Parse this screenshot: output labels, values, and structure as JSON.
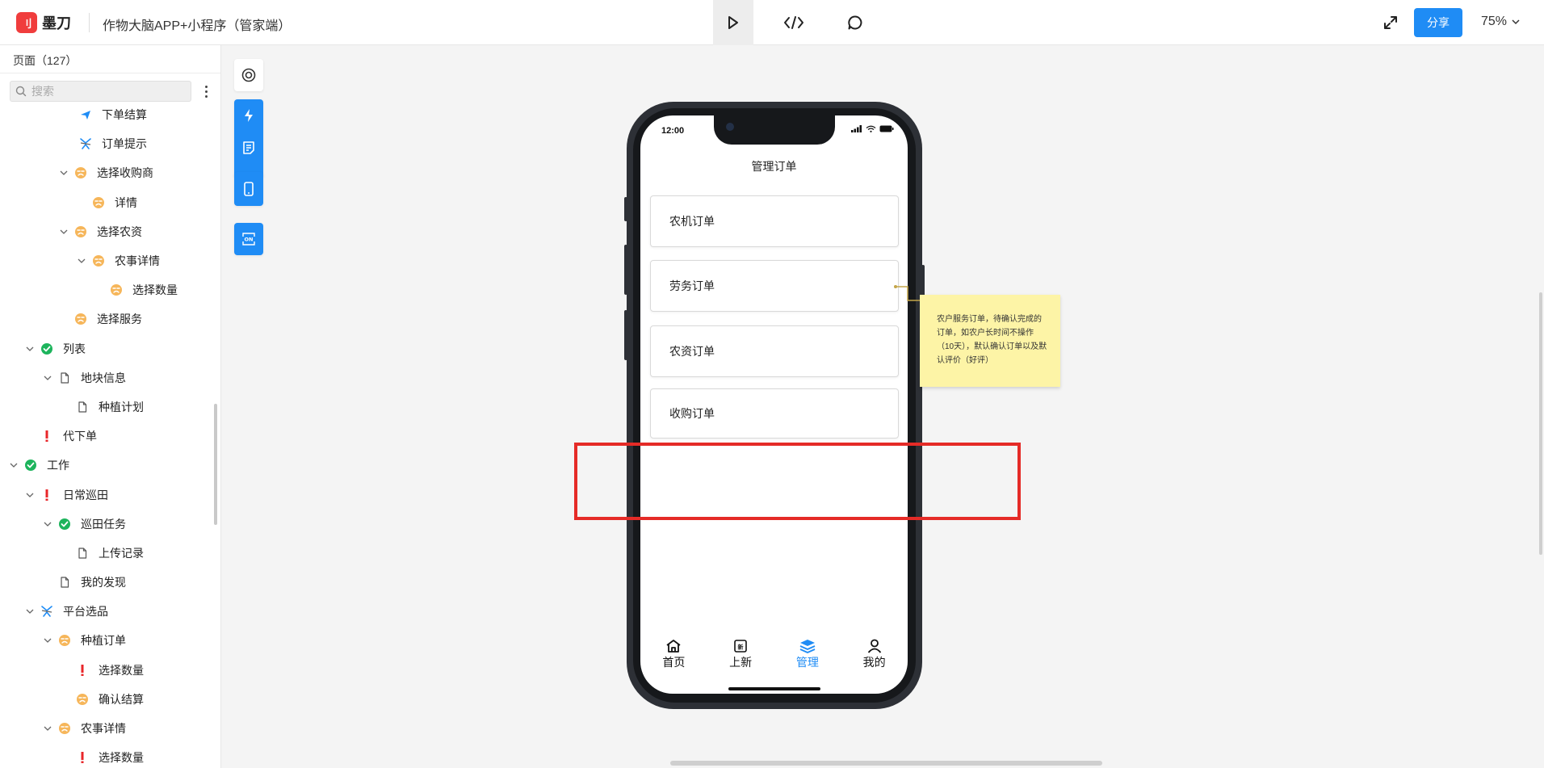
{
  "topbar": {
    "logo_mark": "刂",
    "logo_text": "墨刀",
    "project_title": "作物大脑APP+小程序（管家端）",
    "share_label": "分享",
    "zoom_label": "75%"
  },
  "sidebar": {
    "header": "页面（127）",
    "search_placeholder": "搜索",
    "items": [
      {
        "label": "下单结算",
        "icon": "plane-icon"
      },
      {
        "label": "订单提示",
        "icon": "plane-icon"
      },
      {
        "label": "选择收购商",
        "icon": "pending-icon"
      },
      {
        "label": "详情",
        "icon": "pending-icon"
      },
      {
        "label": "选择农资",
        "icon": "pending-icon"
      },
      {
        "label": "农事详情",
        "icon": "pending-icon"
      },
      {
        "label": "选择数量",
        "icon": "pending-icon"
      },
      {
        "label": "选择服务",
        "icon": "pending-icon"
      },
      {
        "label": "列表",
        "icon": "done-icon"
      },
      {
        "label": "地块信息",
        "icon": "page-icon"
      },
      {
        "label": "种植计划",
        "icon": "page-icon"
      },
      {
        "label": "代下单",
        "icon": "alert-icon"
      },
      {
        "label": "工作",
        "icon": "done-icon"
      },
      {
        "label": "日常巡田",
        "icon": "alert-icon"
      },
      {
        "label": "巡田任务",
        "icon": "done-icon"
      },
      {
        "label": "上传记录",
        "icon": "page-icon"
      },
      {
        "label": "我的发现",
        "icon": "page-icon"
      },
      {
        "label": "平台选品",
        "icon": "plane-icon"
      },
      {
        "label": "种植订单",
        "icon": "pending-icon"
      },
      {
        "label": "选择数量",
        "icon": "alert-icon"
      },
      {
        "label": "确认结算",
        "icon": "pending-icon"
      },
      {
        "label": "农事详情",
        "icon": "pending-icon"
      },
      {
        "label": "选择数量",
        "icon": "alert-icon"
      }
    ]
  },
  "phone": {
    "time": "12:00",
    "title": "管理订单",
    "orders": [
      "农机订单",
      "劳务订单",
      "农资订单",
      "收购订单"
    ],
    "tabs": [
      {
        "label": "首页",
        "icon": "home-icon"
      },
      {
        "label": "上新",
        "icon": "new-icon"
      },
      {
        "label": "管理",
        "icon": "layers-icon"
      },
      {
        "label": "我的",
        "icon": "user-icon"
      }
    ]
  },
  "note": {
    "text": "农户服务订单，待确认完成的订单，如农户长时间不操作（10天），默认确认订单以及默认评价（好评）"
  },
  "colors": {
    "accent": "#1f8cf5",
    "brand": "#f03d3d",
    "highlight": "#e52b27",
    "note_bg": "#fdf4a6",
    "done": "#1db45c",
    "pending": "#f6b65a",
    "alert": "#e8262a"
  }
}
